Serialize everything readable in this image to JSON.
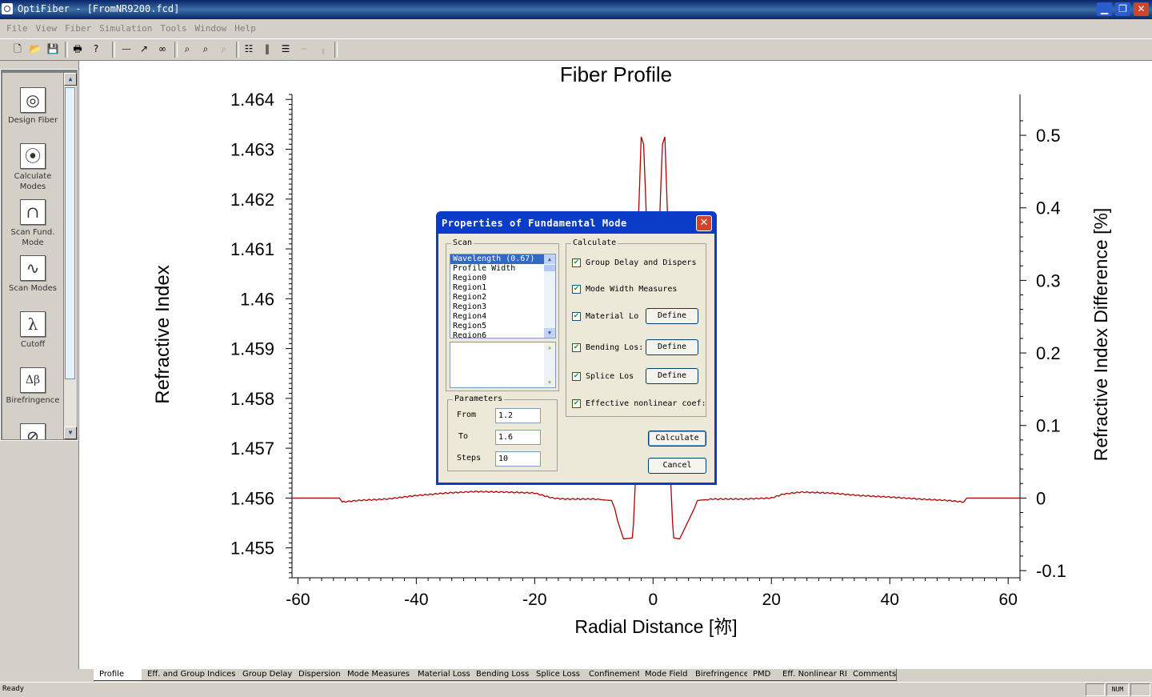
{
  "window": {
    "title": "OptiFiber  - [FromNR9200.fcd]",
    "min": "▁",
    "max": "❐",
    "close": "✕"
  },
  "menu": [
    "File",
    "View",
    "Fiber",
    "Simulation",
    "Tools",
    "Window",
    "Help"
  ],
  "toolbar_icons": [
    "new-file-icon",
    "open-folder-icon",
    "save-disk-icon",
    "print-icon",
    "help-icon",
    "line-tool-icon",
    "axis-tool-icon",
    "glasses-icon",
    "zoom-in-icon",
    "zoom-out-icon",
    "zoom-fit-icon",
    "table-icon",
    "columns-icon",
    "rows-icon",
    "dash-icon",
    "marker-icon"
  ],
  "sidebar": {
    "tools": [
      {
        "label": "Design Fiber",
        "glyph": "◎"
      },
      {
        "label": "Calculate Modes",
        "glyph": "⦿"
      },
      {
        "label": "Scan Fund. Mode",
        "glyph": "∩"
      },
      {
        "label": "Scan Modes",
        "glyph": "∿"
      },
      {
        "label": "Cutoff",
        "glyph": "λ"
      },
      {
        "label": "Birefringence",
        "glyph": "Δβ"
      },
      {
        "label": "",
        "glyph": "⊘"
      }
    ]
  },
  "chart_data": {
    "type": "line",
    "title": "Fiber Profile",
    "xlabel": "Radial Distance [祢]",
    "ylabel": "Refractive Index",
    "y2label": "Refractive Index Difference [%]",
    "xlim": [
      -61,
      62
    ],
    "ylim": [
      1.4544,
      1.4641
    ],
    "xticks": [
      "-60",
      "-40",
      "-20",
      "0",
      "20",
      "40",
      "60"
    ],
    "yticks": [
      "1.464",
      "1.463",
      "1.462",
      "1.461",
      "1.46",
      "1.459",
      "1.458",
      "1.457",
      "1.456",
      "1.455"
    ],
    "y2ticks": [
      "0.5",
      "0.4",
      "0.3",
      "0.2",
      "0.1",
      "0",
      "-0.1"
    ],
    "color": "#b00000",
    "series": [
      {
        "x": [
          -61,
          -53,
          -52.5,
          -50,
          -45,
          -40,
          -35,
          -30,
          -25,
          -20,
          -17,
          -15,
          -10,
          -7,
          -6.5,
          -6,
          -5,
          -3.5,
          -3.3,
          -3,
          -2.5,
          -2,
          -1.6,
          -1.3,
          -1,
          -0.6,
          0.6,
          1,
          1.3,
          1.6,
          2,
          2.5,
          3,
          3.3,
          3.5,
          4.5,
          6,
          7,
          7.5,
          10,
          15,
          20,
          22,
          25,
          30,
          35,
          40,
          45,
          50,
          52.5,
          53,
          62
        ],
        "y": [
          1.456,
          1.456,
          1.45592,
          1.45595,
          1.45598,
          1.45605,
          1.4561,
          1.45613,
          1.45612,
          1.4561,
          1.456,
          1.45598,
          1.45598,
          1.45595,
          1.4558,
          1.45555,
          1.45518,
          1.4552,
          1.4555,
          1.4563,
          1.4615,
          1.46325,
          1.4631,
          1.4622,
          1.4612,
          1.4604,
          1.4604,
          1.4612,
          1.4622,
          1.4631,
          1.46325,
          1.4615,
          1.4563,
          1.4555,
          1.4552,
          1.45518,
          1.45555,
          1.4558,
          1.45595,
          1.45598,
          1.45598,
          1.456,
          1.45608,
          1.45612,
          1.4561,
          1.45605,
          1.45602,
          1.45598,
          1.45595,
          1.45592,
          1.456,
          1.456
        ]
      }
    ]
  },
  "dialog": {
    "title": "Properties of Fundamental Mode",
    "close": "✕",
    "scan_legend": "Scan",
    "scan_items": [
      "Wavelength (0.67)",
      "Profile Width",
      "Region0",
      "Region1",
      "Region2",
      "Region3",
      "Region4",
      "Region5",
      "Region6"
    ],
    "params_legend": "Parameters",
    "from_label": "From",
    "from_value": "1.2",
    "to_label": "To",
    "to_value": "1.6",
    "steps_label": "Steps",
    "steps_value": "10",
    "calc_legend": "Calculate",
    "check_mark": "✔",
    "checks": [
      "Group Delay and Dispers",
      "Mode Width Measures",
      "Material Lo",
      "Bending Los:",
      "Splice Los",
      "Effective nonlinear coef:"
    ],
    "define_label": "Define",
    "calculate_label": "Calculate",
    "cancel_label": "Cancel"
  },
  "tabs": [
    "Profile",
    "Eff. and Group Indices",
    "Group Delay",
    "Dispersion",
    "Mode Measures",
    "Material Loss",
    "Bending Loss",
    "Splice Loss",
    "Confinement",
    "Mode Field",
    "Birefringence",
    "PMD",
    "Eff. Nonlinear RI",
    "Comments"
  ],
  "status": {
    "text": "Ready",
    "num": "NUM"
  }
}
